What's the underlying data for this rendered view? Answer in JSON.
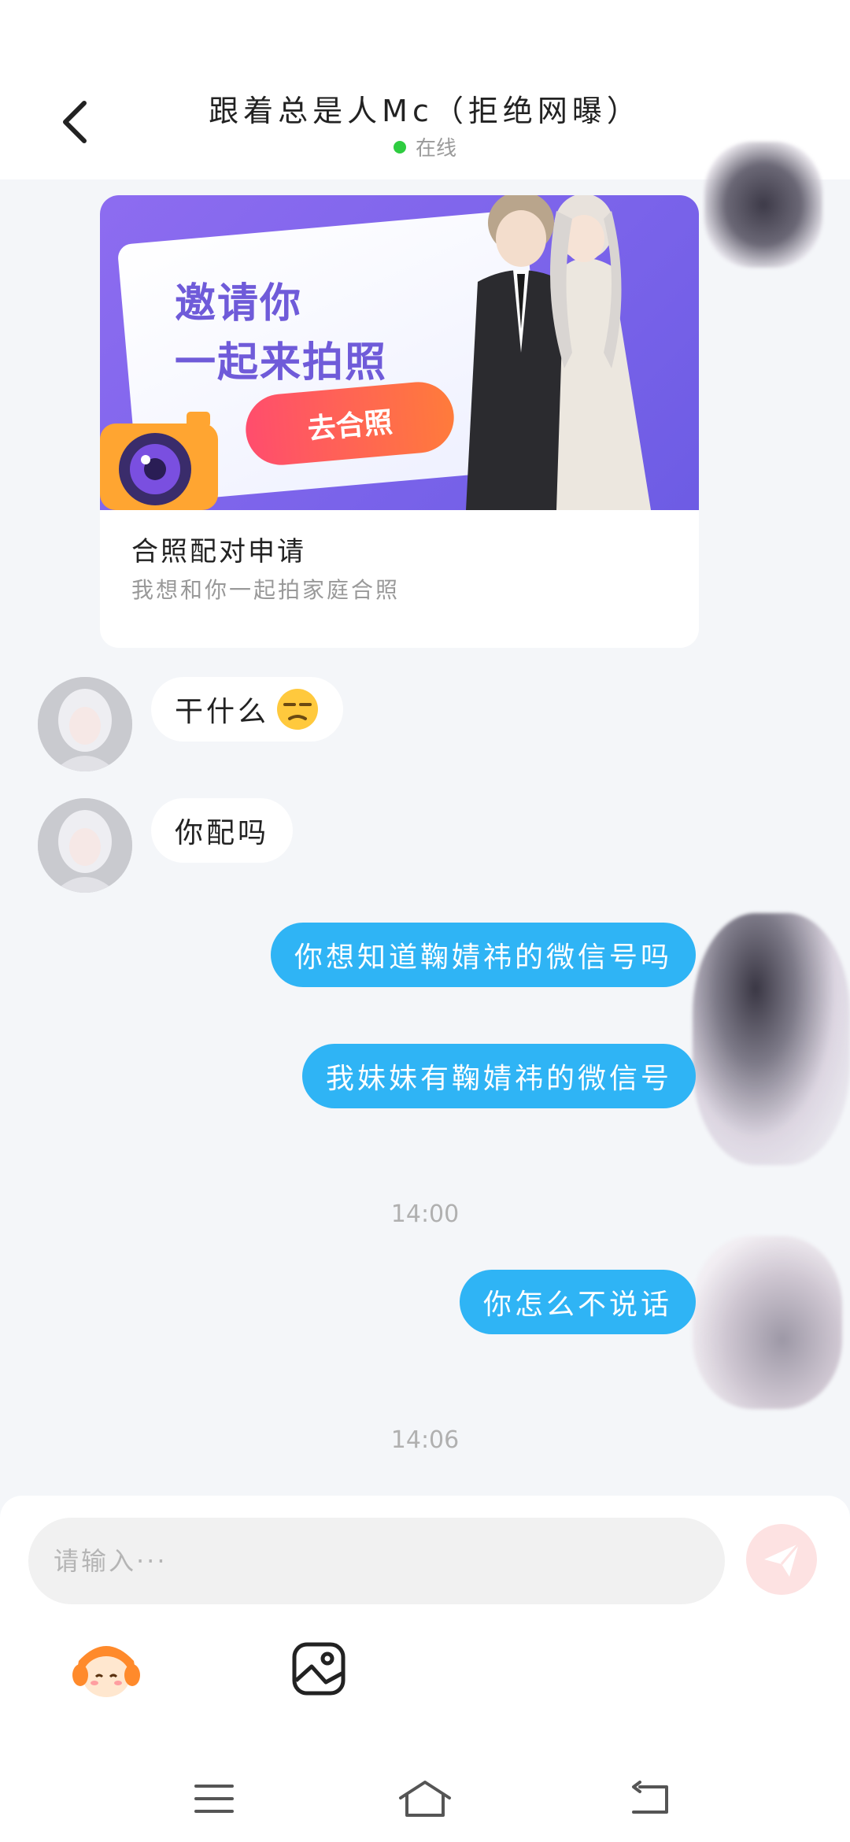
{
  "header": {
    "title": "跟着总是人Mc（拒绝网曝）",
    "status": "在线",
    "back_icon": "chevron-left-icon"
  },
  "card": {
    "banner_line1": "邀请你",
    "banner_line2": "一起来拍照",
    "banner_button": "去合照",
    "title": "合照配对申请",
    "subtitle": "我想和你一起拍家庭合照"
  },
  "messages": [
    {
      "side": "in",
      "text": "干什么",
      "emoji": "unamused-face"
    },
    {
      "side": "in",
      "text": "你配吗"
    },
    {
      "side": "out",
      "text": "你想知道鞠婧祎的微信号吗"
    },
    {
      "side": "out",
      "text": "我妹妹有鞠婧祎的微信号"
    },
    {
      "side": "time",
      "text": "14:00"
    },
    {
      "side": "out",
      "text": "你怎么不说话"
    },
    {
      "side": "time",
      "text": "14:06"
    }
  ],
  "input": {
    "placeholder": "请输入···",
    "send_icon": "send-icon",
    "tools": [
      "sticker-icon",
      "image-icon"
    ]
  },
  "navbar": {
    "icons": [
      "menu-icon",
      "home-icon",
      "back-icon"
    ]
  },
  "colors": {
    "outgoing_bubble": "#2fb4f5",
    "incoming_bubble": "#ffffff",
    "online": "#2ecc40",
    "banner": "#7a63ea",
    "banner_button": "#ff5a5a"
  }
}
